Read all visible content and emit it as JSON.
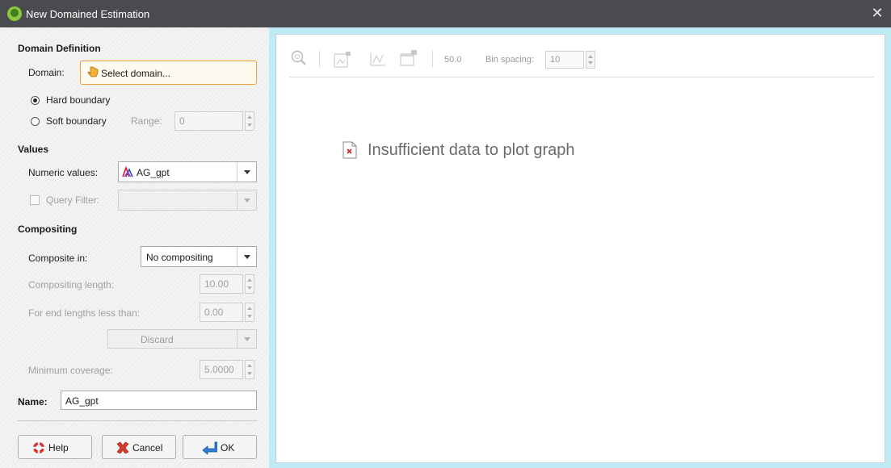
{
  "window": {
    "title": "New Domained Estimation"
  },
  "domain_definition": {
    "header": "Domain Definition",
    "domain_label": "Domain:",
    "select_domain_label": "Select domain...",
    "hard_boundary_label": "Hard boundary",
    "soft_boundary_label": "Soft boundary",
    "range_label": "Range:",
    "range_value": "0",
    "selected_boundary": "Hard boundary"
  },
  "values": {
    "header": "Values",
    "numeric_values_label": "Numeric values:",
    "numeric_values_selected": "AG_gpt",
    "query_filter_label": "Query Filter:",
    "query_filter_value": ""
  },
  "compositing": {
    "header": "Compositing",
    "composite_in_label": "Composite in:",
    "composite_in_value": "No compositing",
    "compositing_length_label": "Compositing length:",
    "compositing_length_value": "10.00",
    "end_lengths_label": "For end lengths less than:",
    "end_lengths_value": "0.00",
    "end_action_value": "Discard",
    "minimum_coverage_label": "Minimum coverage:",
    "minimum_coverage_value": "5.0000"
  },
  "name": {
    "label": "Name:",
    "value": "AG_gpt"
  },
  "buttons": {
    "help": "Help",
    "cancel": "Cancel",
    "ok": "OK"
  },
  "plot": {
    "toolbar": {
      "zoom_value": "50.0",
      "bin_spacing_label": "Bin spacing:",
      "bin_spacing_value": "10"
    },
    "message": "Insufficient data to plot graph"
  },
  "colors": {
    "titlebar": "#494b4e",
    "plot_border_area": "#bfecf4",
    "highlight": "#f0a030"
  }
}
